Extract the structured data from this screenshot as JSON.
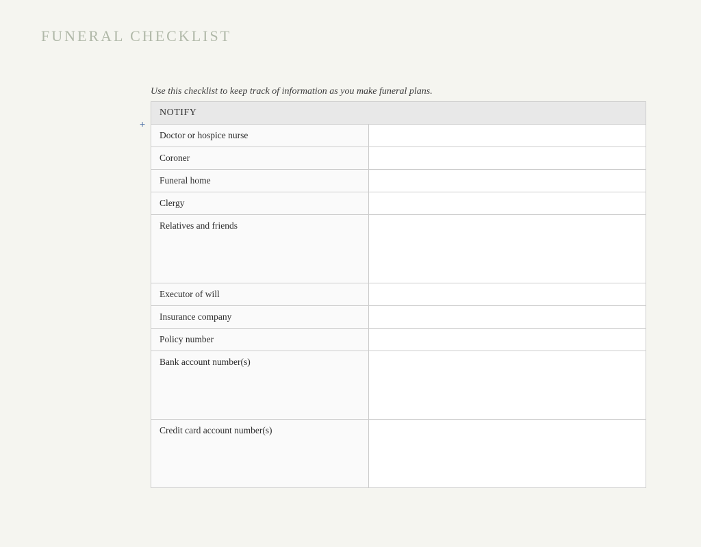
{
  "page": {
    "title": "FUNERAL CHECKLIST",
    "intro": "Use this checklist to keep track of information as you make funeral plans."
  },
  "table": {
    "header": "NOTIFY",
    "add_button": "+",
    "rows": [
      {
        "label": "Doctor or hospice nurse",
        "value": "",
        "height": "normal"
      },
      {
        "label": "Coroner",
        "value": "",
        "height": "normal"
      },
      {
        "label": "Funeral home",
        "value": "",
        "height": "normal"
      },
      {
        "label": "Clergy",
        "value": "",
        "height": "normal"
      },
      {
        "label": "Relatives and friends",
        "value": "",
        "height": "tall"
      },
      {
        "label": "Executor of will",
        "value": "",
        "height": "normal"
      },
      {
        "label": "Insurance company",
        "value": "",
        "height": "normal"
      },
      {
        "label": "Policy number",
        "value": "",
        "height": "normal"
      },
      {
        "label": "Bank account number(s)",
        "value": "",
        "height": "tall"
      },
      {
        "label": "Credit card account number(s)",
        "value": "",
        "height": "tall"
      }
    ]
  }
}
